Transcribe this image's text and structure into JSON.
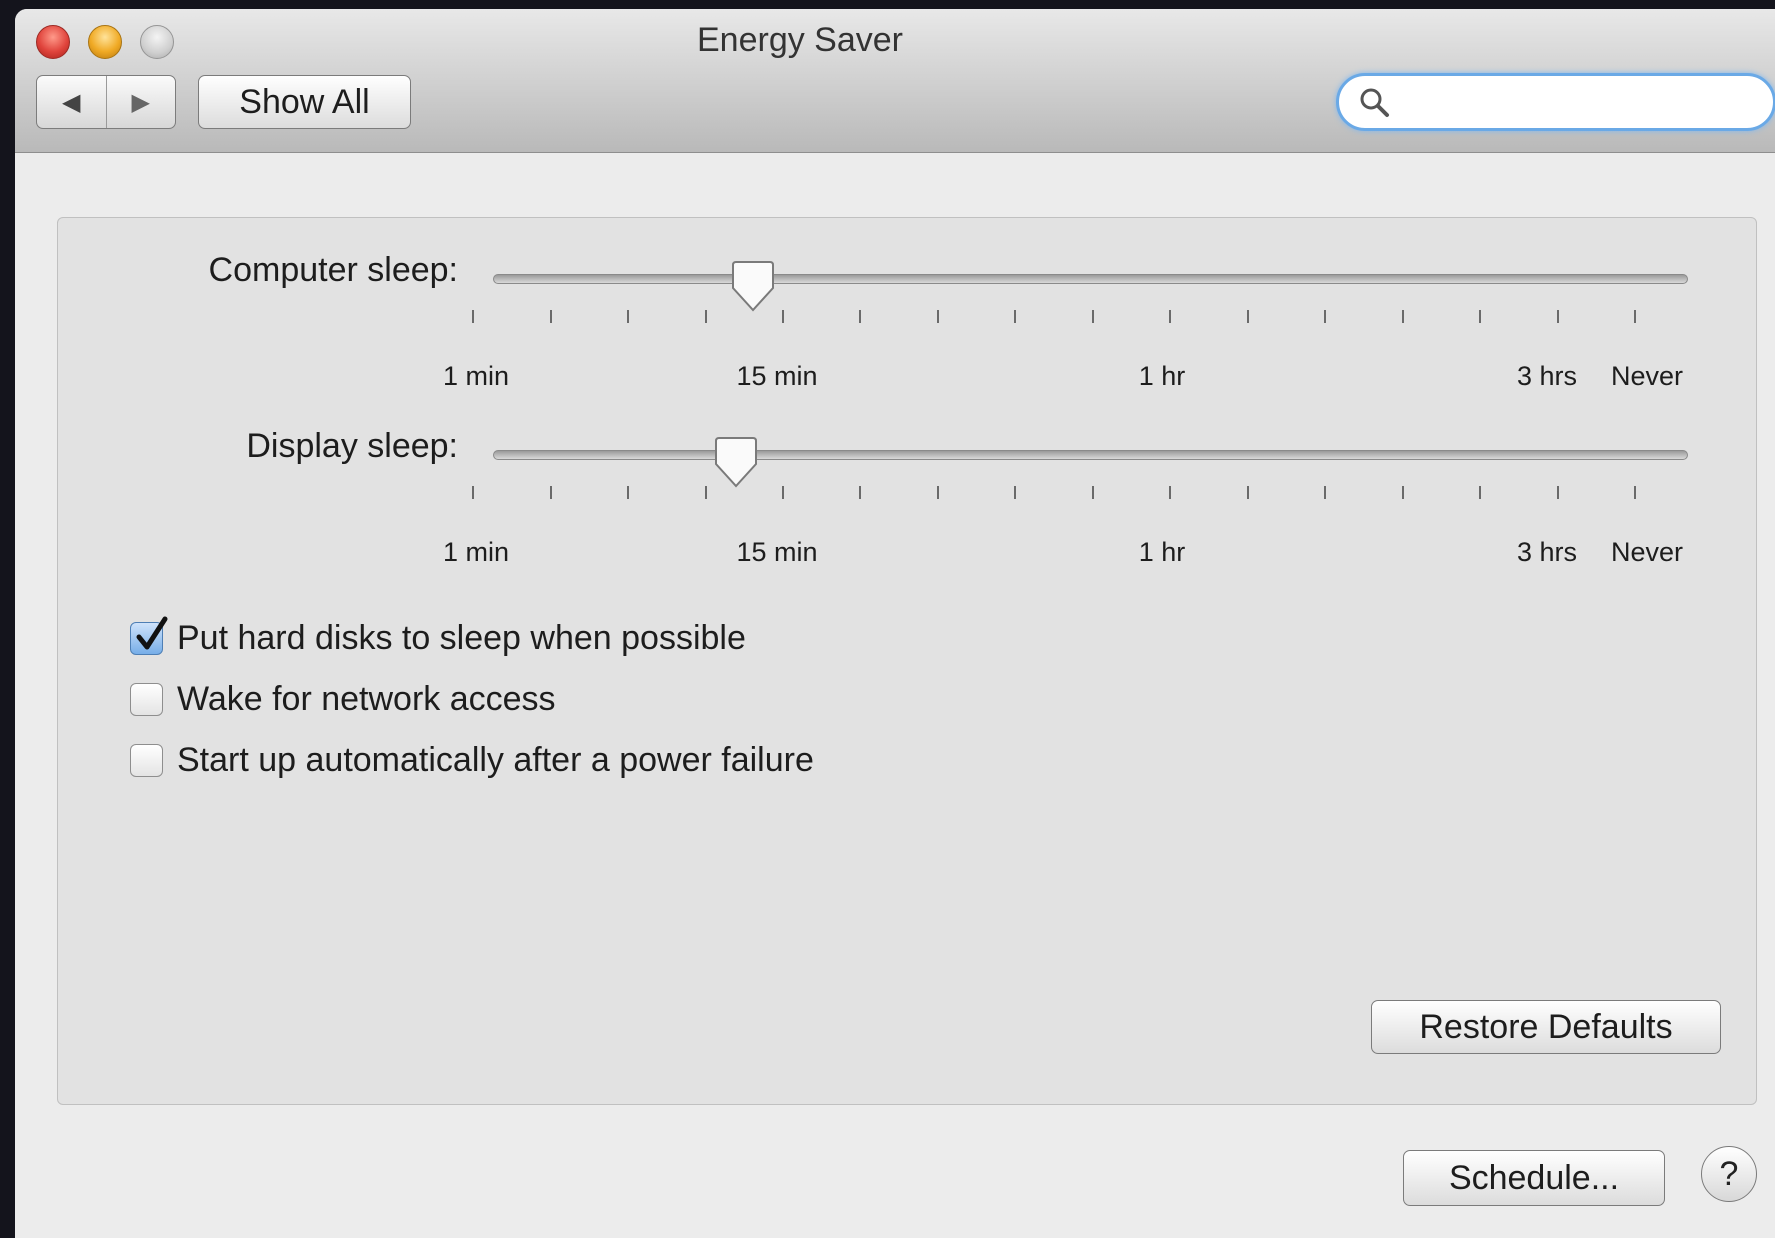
{
  "window": {
    "title": "Energy Saver"
  },
  "toolbar": {
    "show_all_label": "Show All",
    "back_icon": "◀",
    "forward_icon": "▶"
  },
  "search": {
    "placeholder": "",
    "value": "",
    "icon": "search-icon"
  },
  "sliders": {
    "computer_sleep": {
      "label": "Computer sleep:",
      "value": "15 min",
      "tick_labels": [
        "1 min",
        "15 min",
        "1 hr",
        "3 hrs",
        "Never"
      ]
    },
    "display_sleep": {
      "label": "Display sleep:",
      "value": "10 min",
      "tick_labels": [
        "1 min",
        "15 min",
        "1 hr",
        "3 hrs",
        "Never"
      ]
    }
  },
  "options": [
    {
      "label": "Put hard disks to sleep when possible",
      "checked": true
    },
    {
      "label": "Wake for network access",
      "checked": false
    },
    {
      "label": "Start up automatically after a power failure",
      "checked": false
    }
  ],
  "buttons": {
    "restore_defaults": "Restore Defaults",
    "schedule": "Schedule...",
    "help": "?"
  },
  "colors": {
    "search_focus": "#6aa9e6",
    "checkbox_checked": "#77aee8"
  }
}
